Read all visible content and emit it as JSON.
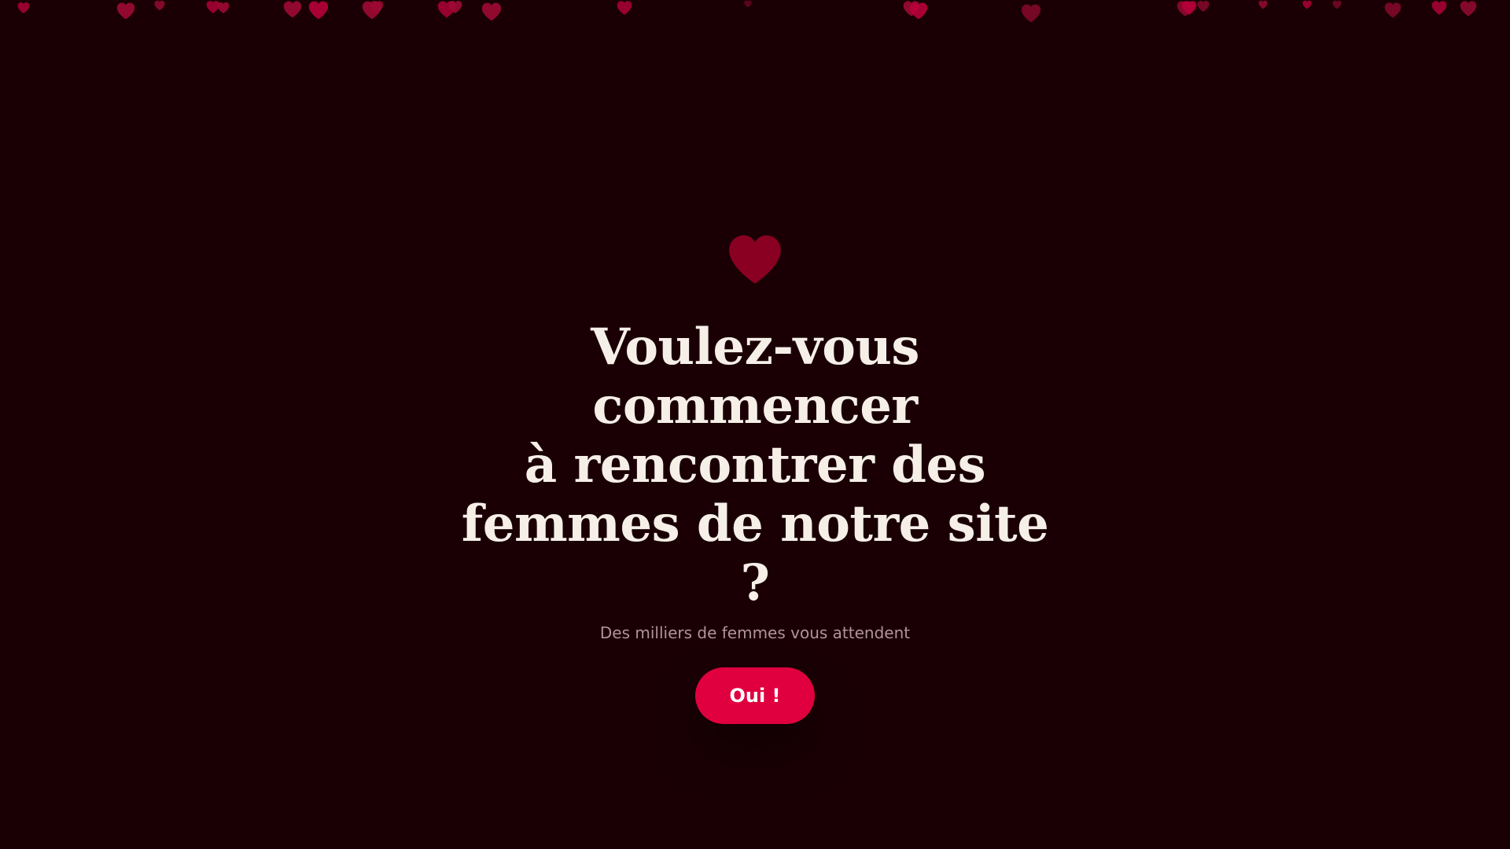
{
  "colors": {
    "background": "#1a0005",
    "accent": "#e0003f",
    "heart": "#8a0022",
    "title_text": "#f6efe8",
    "subtitle_text": "#b3939a"
  },
  "hero": {
    "icon": "heart-icon",
    "title_lines": [
      "Voulez-vous commencer",
      "à rencontrer des",
      "femmes de notre site ?"
    ],
    "subtitle": "Des milliers de femmes vous attendent",
    "cta_label": "Oui !"
  },
  "decoration": {
    "icon": "heart-icon"
  }
}
